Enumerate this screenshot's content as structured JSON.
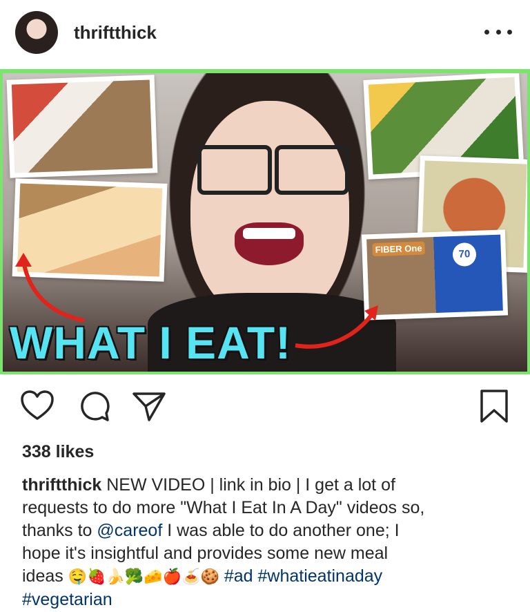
{
  "post": {
    "username": "thriftthick",
    "image_headline": "WHAT I EAT!",
    "image_product_text": [
      "FIBER",
      "One",
      "70"
    ],
    "likes": "338 likes",
    "caption": {
      "user": "thriftthick",
      "line1": " NEW VIDEO | link in bio | I get a lot of",
      "line2": "requests to do more \"What I Eat In A Day\" videos so,",
      "line3_before": "thanks to ",
      "mention": "@careof",
      "line3_after": " I was able to do another one; I",
      "line4": "hope it's insightful and provides some new meal",
      "line5_before": "ideas ",
      "emojis": "🤤🍓🍌🥦🧀🍎🍝🍪",
      "hashtag1": "#ad",
      "hashtag2": "#whatieatinaday",
      "hashtag3": "#vegetarian"
    }
  },
  "icons": {
    "more": "more-options-icon",
    "like": "heart-icon",
    "comment": "comment-icon",
    "share": "share-icon",
    "save": "bookmark-icon"
  },
  "colors": {
    "text": "#262626",
    "link": "#003569",
    "image_border": "#7de36f",
    "headline": "#57e4f2"
  }
}
